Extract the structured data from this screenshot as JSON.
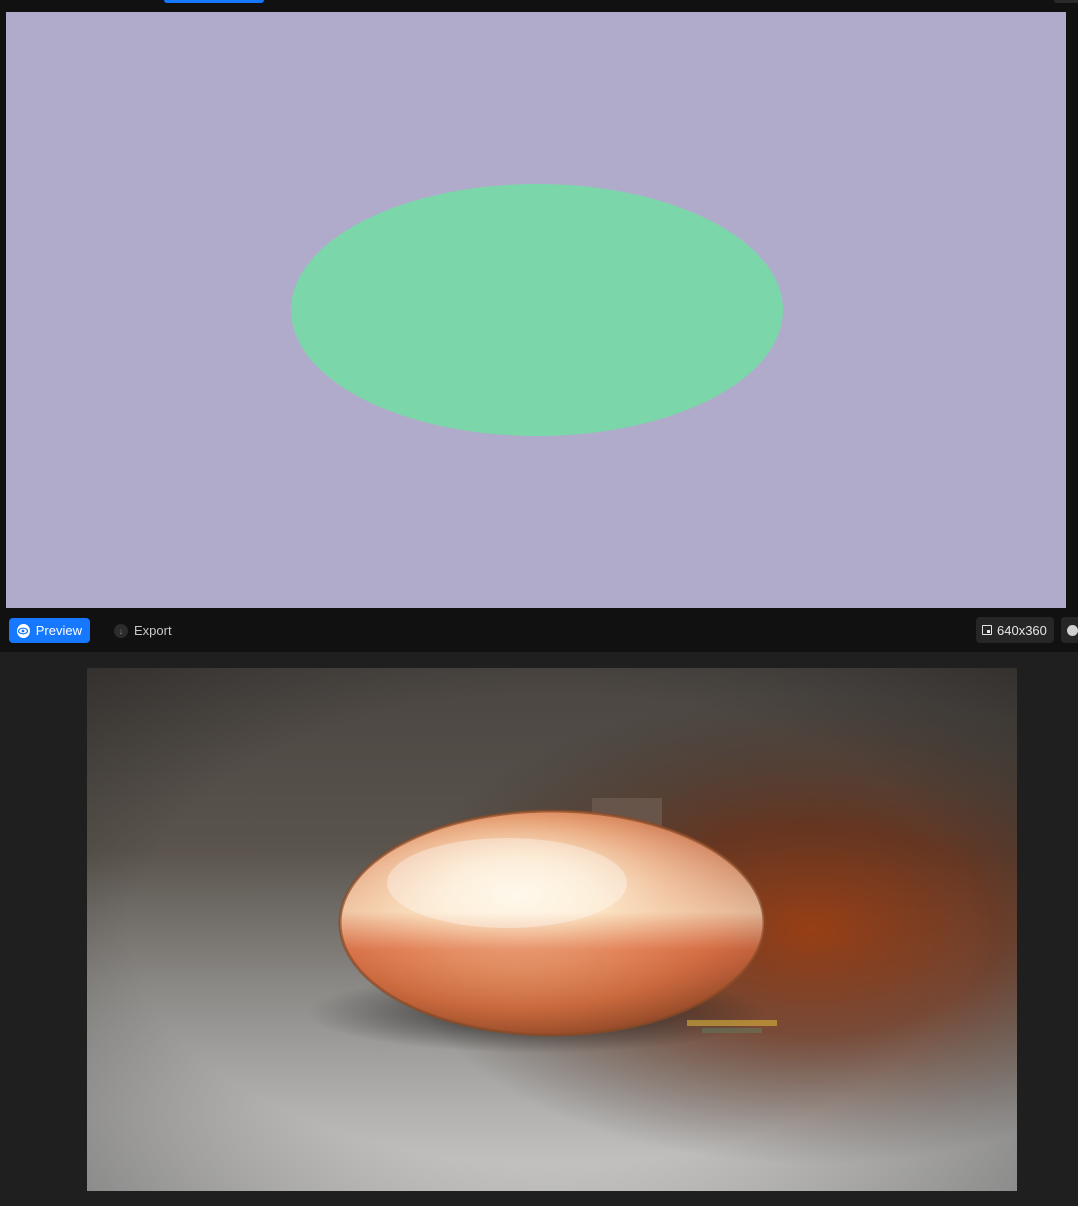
{
  "colors": {
    "accent": "#1677ff",
    "canvas_background": "#b0abcb",
    "ellipse_fill": "#7bd7aa"
  },
  "toolbar": {
    "preview_label": "Preview",
    "export_label": "Export",
    "resolution": "640x360",
    "preview_icon": "eye-icon",
    "export_icon": "download-icon",
    "resolution_icon": "resize-icon",
    "info_icon": "help-icon"
  }
}
